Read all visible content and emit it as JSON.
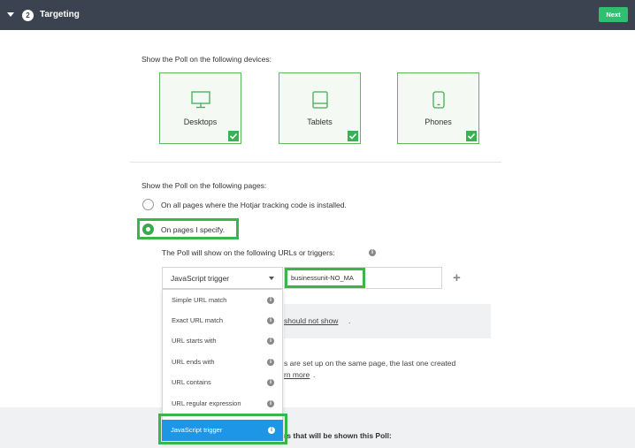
{
  "header": {
    "step": "2",
    "title": "Targeting",
    "next_label": "Next"
  },
  "devices": {
    "heading": "Show the Poll on the following devices:",
    "items": [
      {
        "label": "Desktops",
        "icon": "desktop-icon",
        "checked": true
      },
      {
        "label": "Tablets",
        "icon": "tablet-icon",
        "checked": true
      },
      {
        "label": "Phones",
        "icon": "phone-icon",
        "checked": true
      }
    ]
  },
  "pages": {
    "heading": "Show the Poll on the following pages:",
    "option_all": "On all pages where the Hotjar tracking code is installed.",
    "option_specify": "On pages I specify.",
    "selected": "option_specify",
    "urls_heading": "The Poll will show on the following URLs or triggers:",
    "trigger_type": "JavaScript trigger",
    "trigger_value": "businessunit-NO_MA",
    "not_show_link": "should not show",
    "not_show_period": ".",
    "info_line": "s are set up on the same page, the last one created",
    "learn_more": "rn more",
    "learn_more_period": ".",
    "bottom_text": "rs that will be shown this Poll:"
  },
  "dropdown": {
    "options": [
      "Simple URL match",
      "Exact URL match",
      "URL starts with",
      "URL ends with",
      "URL contains",
      "URL regular expression"
    ],
    "selected": "JavaScript trigger"
  },
  "colors": {
    "header_bg": "#3c4350",
    "accent_green": "#2fbf71",
    "highlight_green": "#3ab54a",
    "select_blue": "#1e96e8"
  }
}
